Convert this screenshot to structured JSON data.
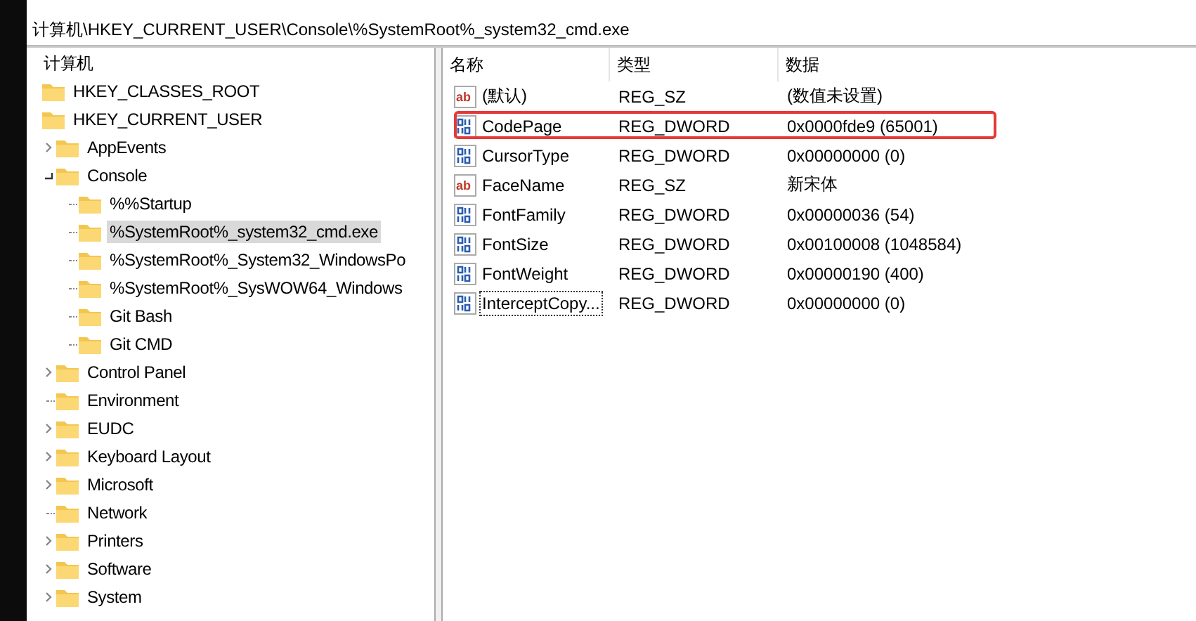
{
  "address_bar": {
    "value": "计算机\\HKEY_CURRENT_USER\\Console\\%SystemRoot%_system32_cmd.exe"
  },
  "tree": {
    "label": "计算机",
    "selected": false,
    "children": [
      {
        "label": "HKEY_CLASSES_ROOT",
        "selected": false
      },
      {
        "label": "HKEY_CURRENT_USER",
        "selected": false,
        "children": [
          {
            "label": "AppEvents",
            "expanded": false,
            "selected": false
          },
          {
            "label": "Console",
            "expanded": true,
            "selected": false,
            "children": [
              {
                "label": "%%Startup",
                "selected": false
              },
              {
                "label": "%SystemRoot%_system32_cmd.exe",
                "selected": true
              },
              {
                "label": "%SystemRoot%_System32_WindowsPo",
                "selected": false
              },
              {
                "label": "%SystemRoot%_SysWOW64_Windows",
                "selected": false
              },
              {
                "label": "Git Bash",
                "selected": false
              },
              {
                "label": "Git CMD",
                "selected": false
              }
            ]
          },
          {
            "label": "Control Panel",
            "expanded": false,
            "selected": false
          },
          {
            "label": "Environment",
            "selected": false
          },
          {
            "label": "EUDC",
            "expanded": false,
            "selected": false
          },
          {
            "label": "Keyboard Layout",
            "expanded": false,
            "selected": false
          },
          {
            "label": "Microsoft",
            "expanded": false,
            "selected": false
          },
          {
            "label": "Network",
            "selected": false
          },
          {
            "label": "Printers",
            "expanded": false,
            "selected": false
          },
          {
            "label": "Software",
            "expanded": false,
            "selected": false
          },
          {
            "label": "System",
            "expanded": false,
            "selected": false
          }
        ]
      }
    ]
  },
  "values_table": {
    "columns": [
      "名称",
      "类型",
      "数据"
    ],
    "rows": [
      {
        "kind": "string",
        "icon_text": "ab",
        "name": "(默认)",
        "type": "REG_SZ",
        "data": "(数值未设置)",
        "highlighted": false,
        "focused": false
      },
      {
        "kind": "dword",
        "name": "CodePage",
        "type": "REG_DWORD",
        "data": "0x0000fde9 (65001)",
        "highlighted": true,
        "focused": false
      },
      {
        "kind": "dword",
        "name": "CursorType",
        "type": "REG_DWORD",
        "data": "0x00000000 (0)",
        "highlighted": false,
        "focused": false
      },
      {
        "kind": "string",
        "icon_text": "ab",
        "name": "FaceName",
        "type": "REG_SZ",
        "data": "新宋体",
        "highlighted": false,
        "focused": false
      },
      {
        "kind": "dword",
        "name": "FontFamily",
        "type": "REG_DWORD",
        "data": "0x00000036 (54)",
        "highlighted": false,
        "focused": false
      },
      {
        "kind": "dword",
        "name": "FontSize",
        "type": "REG_DWORD",
        "data": "0x00100008 (1048584)",
        "highlighted": false,
        "focused": false
      },
      {
        "kind": "dword",
        "name": "FontWeight",
        "type": "REG_DWORD",
        "data": "0x00000190 (400)",
        "highlighted": false,
        "focused": false
      },
      {
        "kind": "dword",
        "name": "InterceptCopy...",
        "type": "REG_DWORD",
        "data": "0x00000000 (0)",
        "highlighted": false,
        "focused": true
      }
    ]
  }
}
